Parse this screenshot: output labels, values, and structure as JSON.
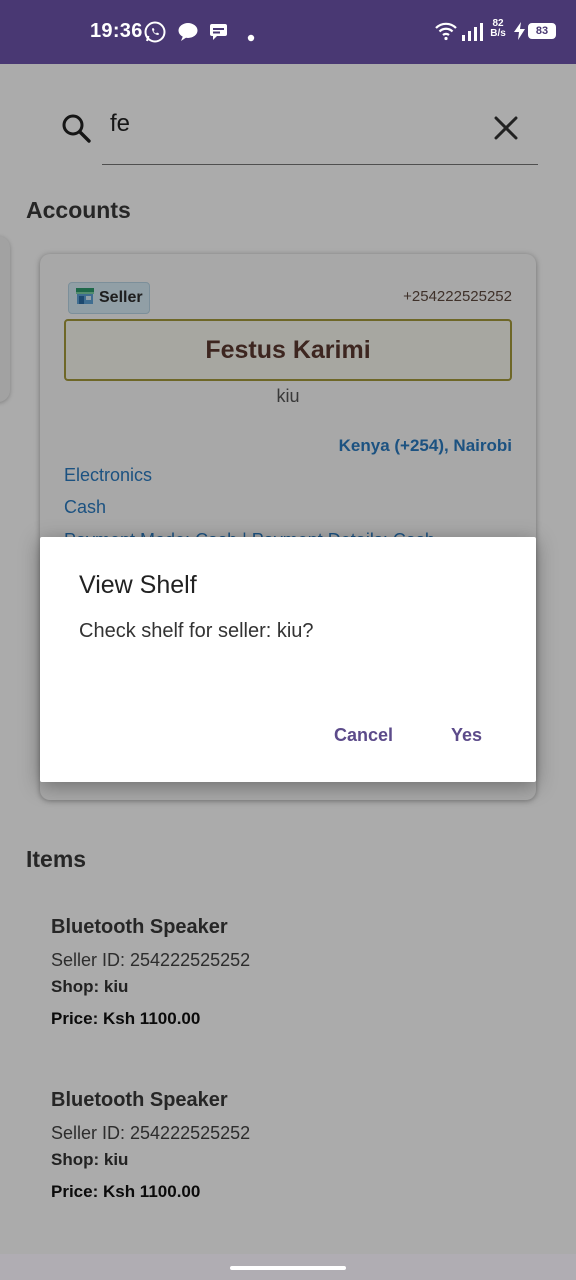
{
  "status_bar": {
    "time": "19:36",
    "net_speed_value": "82",
    "net_speed_unit": "B/s",
    "battery": "83",
    "icons": [
      "whatsapp-icon",
      "chat-bubble-icon",
      "message-icon",
      "dot-icon",
      "wifi-icon",
      "signal-icon",
      "charging-icon"
    ]
  },
  "search": {
    "value": "fe",
    "placeholder": ""
  },
  "accounts_section": {
    "title": "Accounts",
    "card": {
      "role_badge": "Seller",
      "phone": "+254222525252",
      "name": "Festus Karimi",
      "shop": "kiu",
      "location": "Kenya (+254), Nairobi",
      "category": "Electronics",
      "payment": "Cash",
      "payment_details": "Payment Mode: Cash | Payment Details: Cash"
    }
  },
  "items_section": {
    "title": "Items",
    "items": [
      {
        "name": "Bluetooth Speaker",
        "seller_id": "Seller ID: 254222525252",
        "shop": "Shop: kiu",
        "price": "Price: Ksh 1100.00"
      },
      {
        "name": "Bluetooth Speaker",
        "seller_id": "Seller ID: 254222525252",
        "shop": "Shop: kiu",
        "price": "Price: Ksh 1100.00"
      }
    ]
  },
  "dialog": {
    "title": "View Shelf",
    "message": "Check shelf for seller: kiu?",
    "cancel_label": "Cancel",
    "confirm_label": "Yes"
  },
  "colors": {
    "status_bar": "#493873",
    "accent_link": "#2a7bc0",
    "dialog_button": "#5c4b8a",
    "name_border": "#a59a3b"
  }
}
